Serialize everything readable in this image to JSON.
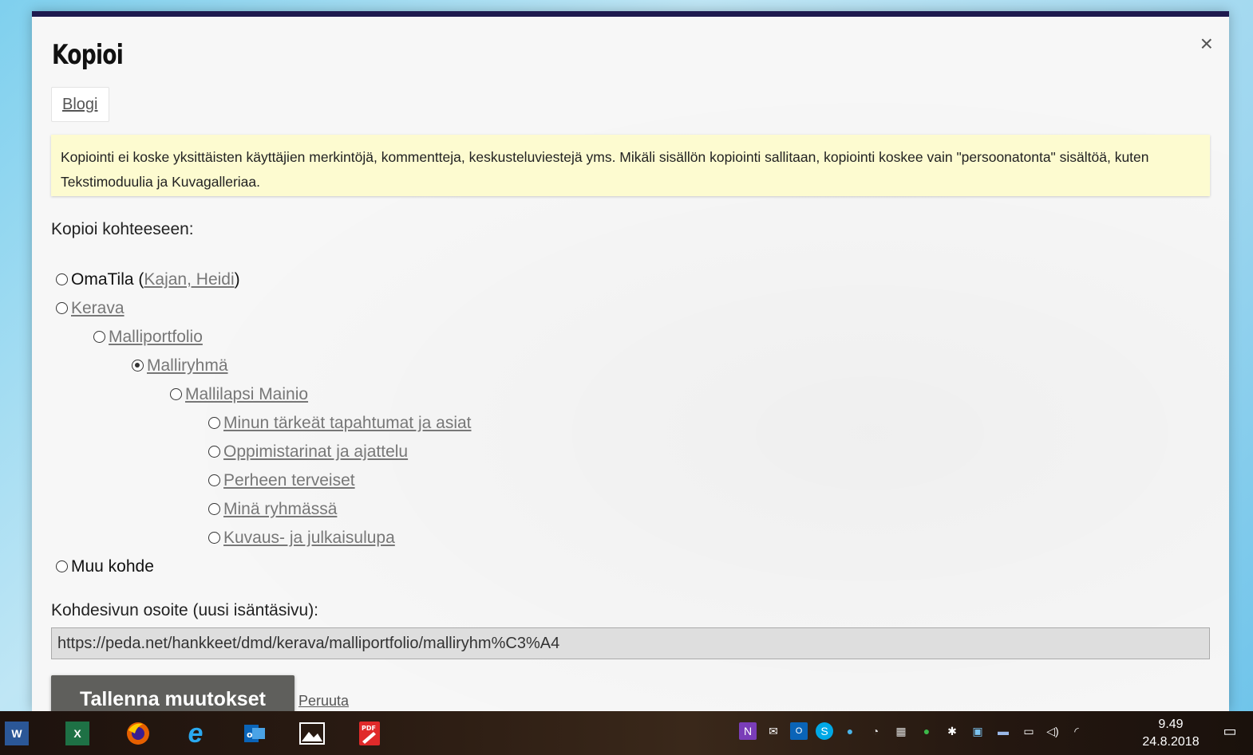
{
  "dialog": {
    "title": "Kopioi",
    "close_label": "×",
    "tab_label": "Blogi",
    "notice_text": "Kopiointi ei koske yksittäisten käyttäjien merkintöjä, kommentteja, keskusteluviestejä yms. Mikäli sisällön kopiointi sallitaan, kopiointi koskee vain \"persoonatonta\" sisältöä, kuten Tekstimoduulia ja Kuvagalleriaa.",
    "target_label": "Kopioi kohteeseen:",
    "options": [
      {
        "text": "OmaTila (",
        "link": "Kajan, Heidi",
        "suffix": ")",
        "checked": false
      },
      {
        "link": "Kerava",
        "checked": false
      },
      {
        "link": "Malliportfolio",
        "checked": false
      },
      {
        "link": "Malliryhmä",
        "checked": true
      },
      {
        "link": "Mallilapsi Mainio",
        "checked": false
      },
      {
        "link": "Minun tärkeät tapahtumat ja asiat",
        "checked": false
      },
      {
        "link": "Oppimistarinat ja ajattelu",
        "checked": false
      },
      {
        "link": "Perheen terveiset",
        "checked": false
      },
      {
        "link": "Minä ryhmässä",
        "checked": false
      },
      {
        "link": "Kuvaus- ja julkaisulupa",
        "checked": false
      },
      {
        "text": "Muu kohde",
        "checked": false
      }
    ],
    "url_label": "Kohdesivun osoite (uusi isäntäsivu):",
    "url_value": "https://peda.net/hankkeet/dmd/kerava/malliportfolio/malliryhm%C3%A4",
    "save_label": "Tallenna muutokset",
    "cancel_label": "Peruuta"
  },
  "taskbar": {
    "apps": [
      "word-icon",
      "excel-icon",
      "firefox-icon",
      "edge-icon",
      "outlook-icon",
      "photos-icon",
      "pdf-icon"
    ],
    "tray": [
      "onenote-icon",
      "mail-icon",
      "outlook-tray-icon",
      "skype-icon",
      "network-icon",
      "drive-icon",
      "calendar-icon",
      "sync-icon",
      "bluetooth-icon",
      "app-icon",
      "display-icon",
      "battery-icon",
      "volume-icon",
      "wifi-icon"
    ],
    "time": "9.49",
    "date": "24.8.2018"
  },
  "colors": {
    "header_bar": "#1e1a4f",
    "notice_bg": "#fdfbd0",
    "save_button": "#5f5f5c"
  }
}
